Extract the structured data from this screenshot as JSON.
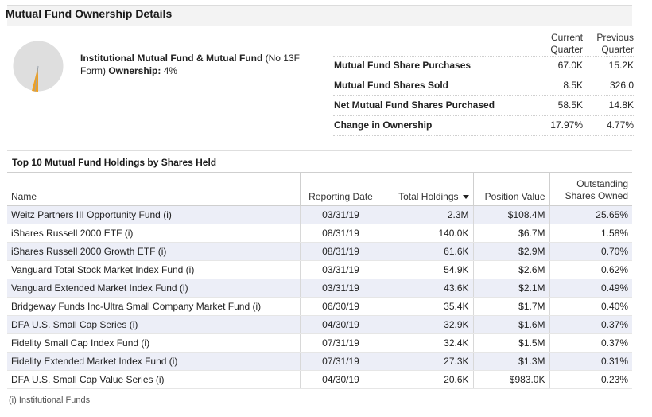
{
  "section": {
    "title": "Mutual Fund Ownership Details"
  },
  "ownership": {
    "label": "Institutional Mutual Fund & Mutual Fund",
    "qualifier": "(No 13F Form)",
    "suffix": "Ownership:",
    "value": "4%",
    "pie_fraction": 0.04,
    "colors": {
      "pie_bg": "#dedede",
      "slice": "#f0a020",
      "slice_stripe": "#9aa3ad"
    }
  },
  "summary": {
    "col_current": [
      "Current",
      "Quarter"
    ],
    "col_previous": [
      "Previous",
      "Quarter"
    ],
    "rows": [
      {
        "label": "Mutual Fund Share Purchases",
        "current": "67.0K",
        "previous": "15.2K"
      },
      {
        "label": "Mutual Fund Shares Sold",
        "current": "8.5K",
        "previous": "326.0"
      },
      {
        "label": "Net Mutual Fund Shares Purchased",
        "current": "58.5K",
        "previous": "14.8K"
      },
      {
        "label": "Change in Ownership",
        "current": "17.97%",
        "previous": "4.77%"
      }
    ]
  },
  "holdings": {
    "title": "Top 10 Mutual Fund Holdings by Shares Held",
    "columns": {
      "name": "Name",
      "date": "Reporting Date",
      "total": "Total Holdings",
      "value": "Position Value",
      "outstanding": [
        "Outstanding",
        "Shares Owned"
      ]
    },
    "rows": [
      {
        "name": "Weitz Partners III Opportunity Fund (i)",
        "date": "03/31/19",
        "total": "2.3M",
        "value": "$108.4M",
        "pct": "25.65%"
      },
      {
        "name": "iShares Russell 2000 ETF (i)",
        "date": "08/31/19",
        "total": "140.0K",
        "value": "$6.7M",
        "pct": "1.58%"
      },
      {
        "name": "iShares Russell 2000 Growth ETF (i)",
        "date": "08/31/19",
        "total": "61.6K",
        "value": "$2.9M",
        "pct": "0.70%"
      },
      {
        "name": "Vanguard Total Stock Market Index Fund (i)",
        "date": "03/31/19",
        "total": "54.9K",
        "value": "$2.6M",
        "pct": "0.62%"
      },
      {
        "name": "Vanguard Extended Market Index Fund (i)",
        "date": "03/31/19",
        "total": "43.6K",
        "value": "$2.1M",
        "pct": "0.49%"
      },
      {
        "name": "Bridgeway Funds Inc-Ultra Small Company Market Fund (i)",
        "date": "06/30/19",
        "total": "35.4K",
        "value": "$1.7M",
        "pct": "0.40%"
      },
      {
        "name": "DFA U.S. Small Cap Series (i)",
        "date": "04/30/19",
        "total": "32.9K",
        "value": "$1.6M",
        "pct": "0.37%"
      },
      {
        "name": "Fidelity Small Cap Index Fund (i)",
        "date": "07/31/19",
        "total": "32.4K",
        "value": "$1.5M",
        "pct": "0.37%"
      },
      {
        "name": "Fidelity Extended Market Index Fund (i)",
        "date": "07/31/19",
        "total": "27.3K",
        "value": "$1.3M",
        "pct": "0.31%"
      },
      {
        "name": "DFA U.S. Small Cap Value Series (i)",
        "date": "04/30/19",
        "total": "20.6K",
        "value": "$983.0K",
        "pct": "0.23%"
      }
    ]
  },
  "footnote": "(i) Institutional Funds"
}
